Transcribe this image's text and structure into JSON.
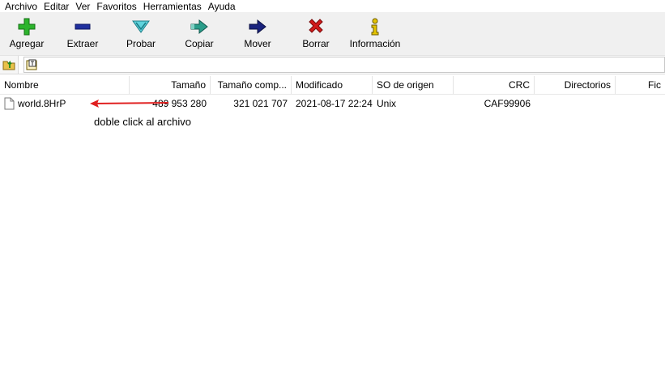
{
  "menu": [
    "Archivo",
    "Editar",
    "Ver",
    "Favoritos",
    "Herramientas",
    "Ayuda"
  ],
  "toolbar": [
    {
      "label": "Agregar",
      "icon": "plus-icon",
      "color": "#2db42d"
    },
    {
      "label": "Extraer",
      "icon": "minus-icon",
      "color": "#1f2f9e"
    },
    {
      "label": "Probar",
      "icon": "check-icon",
      "color": "#23a8b5"
    },
    {
      "label": "Copiar",
      "icon": "copy-arrow-icon",
      "color": "#238a7a"
    },
    {
      "label": "Mover",
      "icon": "move-arrow-icon",
      "color": "#1a237e"
    },
    {
      "label": "Borrar",
      "icon": "delete-x-icon",
      "color": "#d11a1a"
    },
    {
      "label": "Información",
      "icon": "info-icon",
      "color": "#e5c400"
    }
  ],
  "address": {
    "value": "",
    "icon": "archive-root-icon"
  },
  "columns": [
    "Nombre",
    "Tamaño",
    "Tamaño comp...",
    "Modificado",
    "SO de origen",
    "CRC",
    "Directorios",
    "Fic"
  ],
  "files": [
    {
      "name": "world.8HrP",
      "size": "489 953 280",
      "packed": "321 021 707",
      "modified": "2021-08-17 22:24",
      "os": "Unix",
      "crc": "CAF99906",
      "dirs": "",
      "files": ""
    }
  ],
  "annotation": {
    "text": "doble click al archivo",
    "color": "#e02020"
  }
}
